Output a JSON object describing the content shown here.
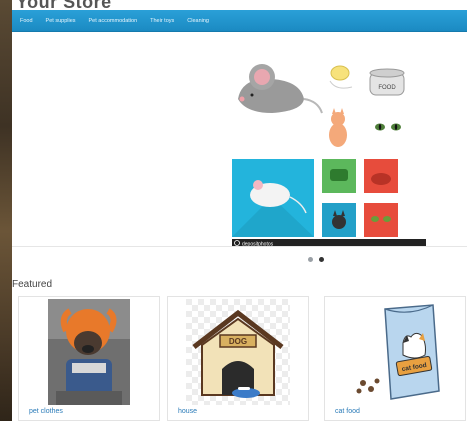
{
  "store": {
    "title": "Your Store"
  },
  "nav": {
    "items": [
      {
        "label": "Food"
      },
      {
        "label": "Pet supplies"
      },
      {
        "label": "Pet accommodation"
      },
      {
        "label": "Their toys"
      },
      {
        "label": "Cleaning"
      }
    ]
  },
  "hero": {
    "banner_tag": "FOOD",
    "watermark": "depositphotos",
    "slides": 2,
    "active_slide": 2
  },
  "featured": {
    "heading": "Featured",
    "products": [
      {
        "name": "pet clothes"
      },
      {
        "name": "house",
        "sign_text": "DOG"
      },
      {
        "name": "cat food",
        "package_text": "cat food"
      }
    ]
  },
  "colors": {
    "nav": "#1e8ec8",
    "link": "#2a7bb8",
    "tile_blue": "#23b4dc",
    "tile_green": "#5cb85c",
    "tile_red": "#e74c3c"
  }
}
